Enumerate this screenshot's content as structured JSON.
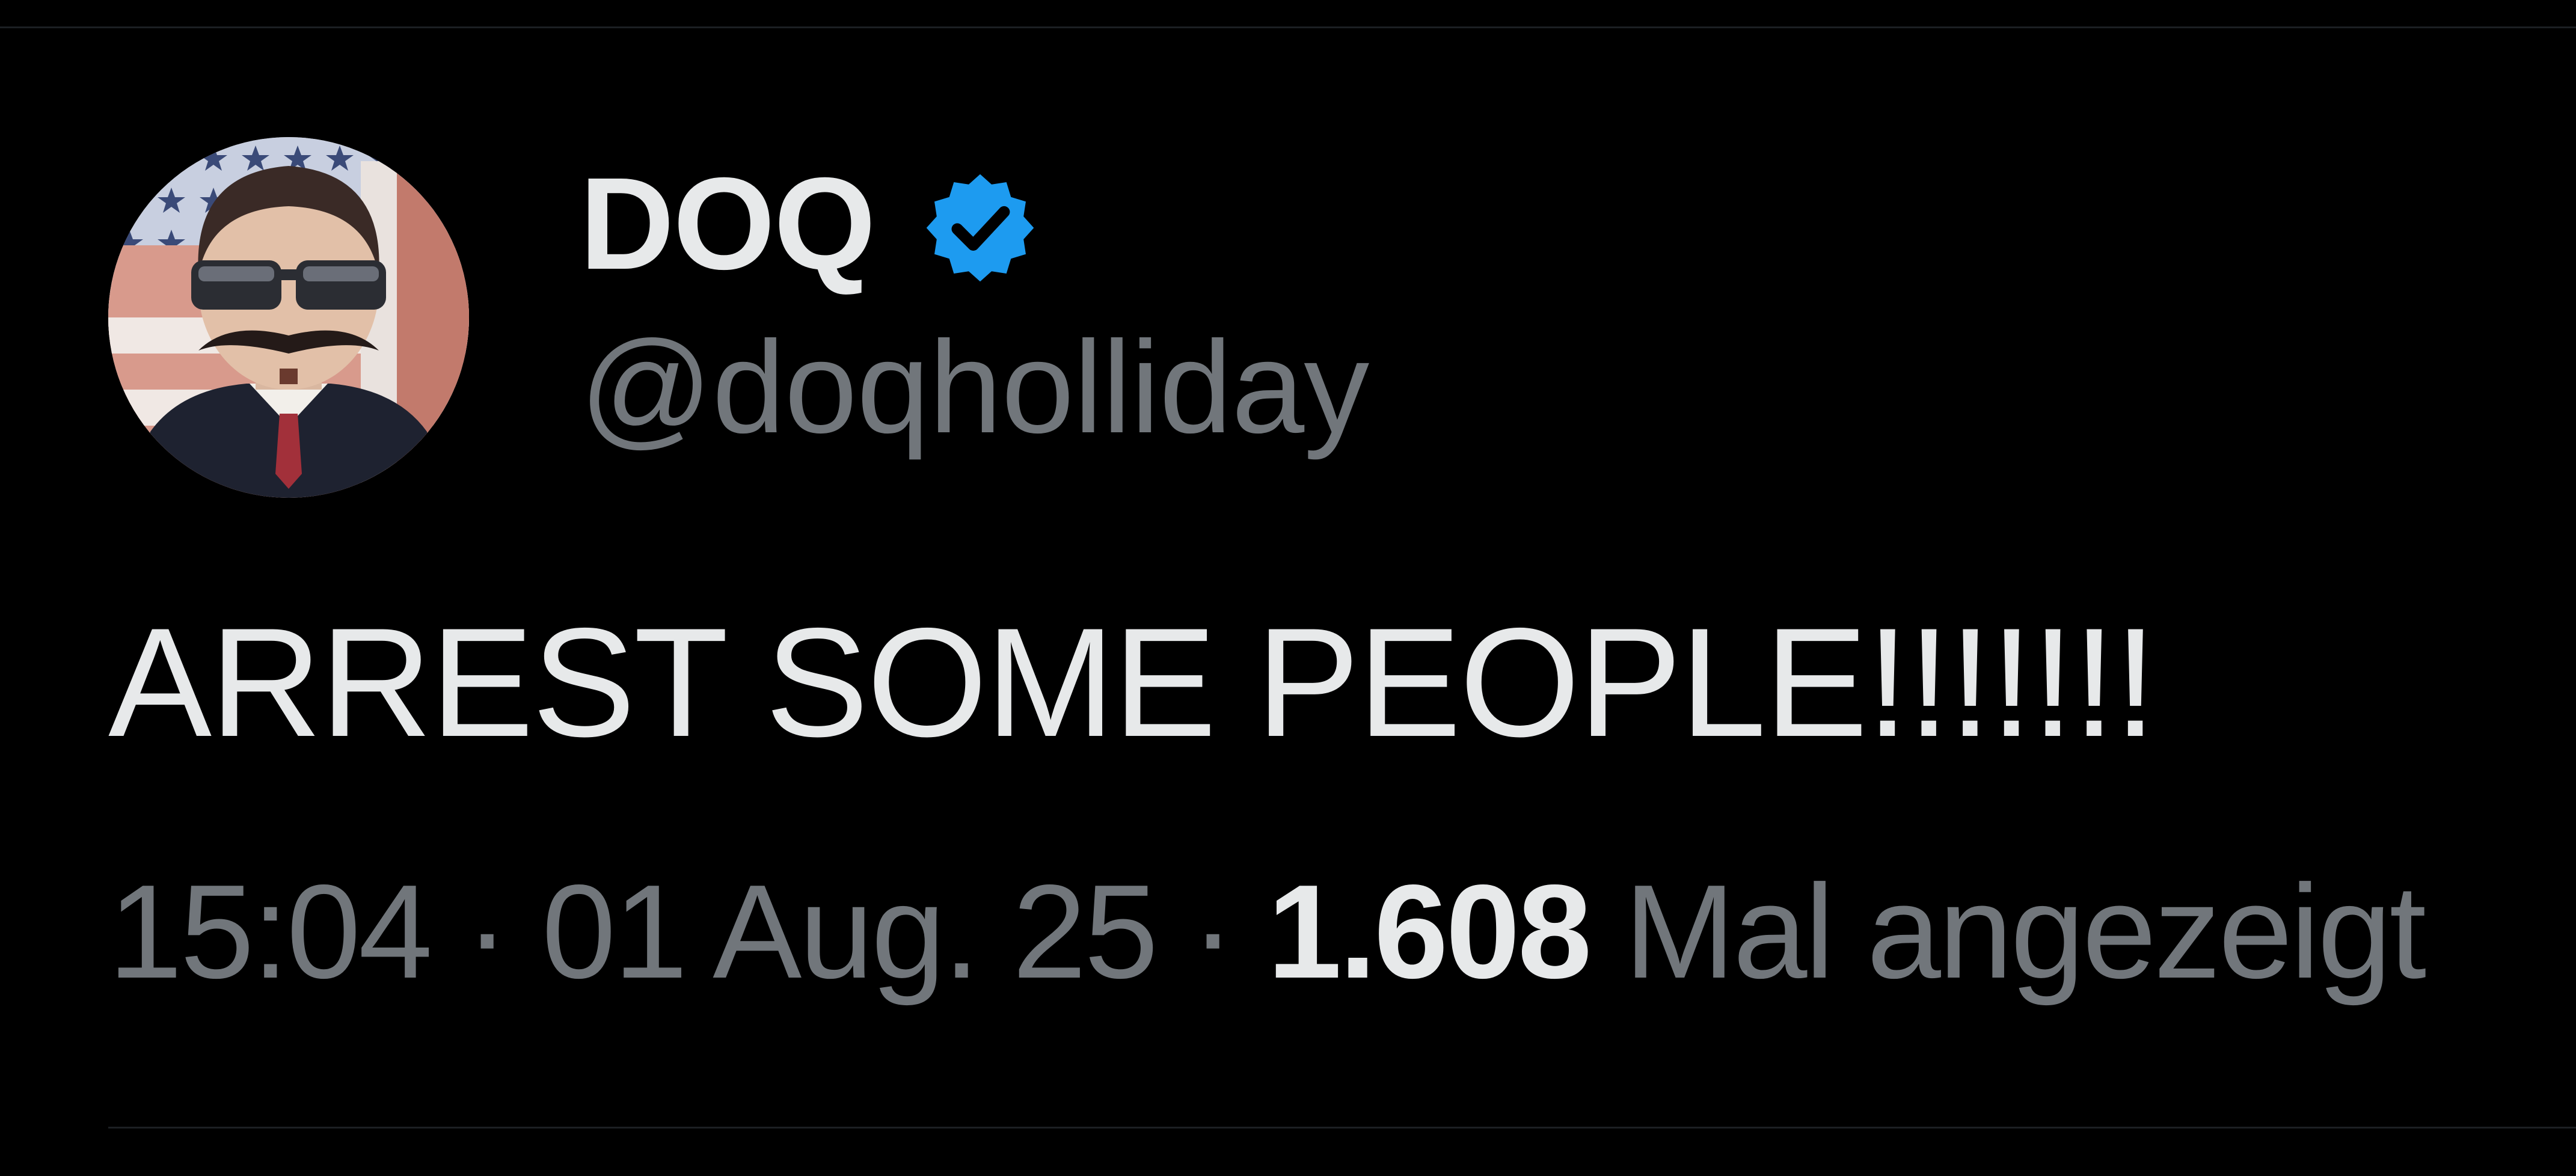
{
  "tweet": {
    "author": {
      "display_name": "DOQ",
      "handle": "@doqholliday",
      "verified": true,
      "verified_badge_color": "#1d9bf0",
      "avatar_icon": "profile-photo"
    },
    "text": "ARREST SOME PEOPLE!!!!!!!",
    "time": "15:04",
    "date": "01 Aug. 25",
    "separator": "·",
    "views_count": "1.608",
    "views_label": "Mal angezeigt"
  },
  "colors": {
    "background": "#000000",
    "primary_text": "#e7e9ea",
    "secondary_text": "#71767b",
    "divider": "#1c1f23"
  }
}
